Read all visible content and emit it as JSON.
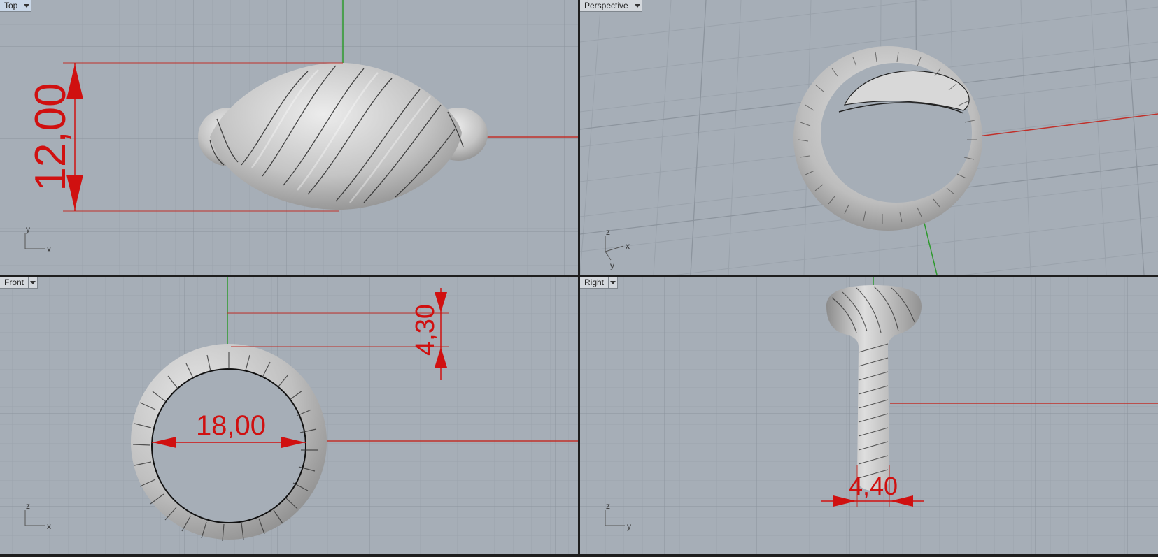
{
  "viewports": {
    "top": {
      "label": "Top",
      "axis_a": "y",
      "axis_b": "x",
      "dimension": "12,00"
    },
    "perspective": {
      "label": "Perspective",
      "axis_a": "z",
      "axis_b": "x",
      "axis_c": "y"
    },
    "front": {
      "label": "Front",
      "axis_a": "z",
      "axis_b": "x",
      "dimension_inner": "18,00",
      "dimension_top": "4,30"
    },
    "right": {
      "label": "Right",
      "axis_a": "z",
      "axis_b": "y",
      "dimension": "4,40"
    }
  },
  "colors": {
    "viewport_bg": "#a6aeb7",
    "grid_minor": "#99a1aa",
    "grid_major": "#8a929b",
    "axis_x": "#c0302a",
    "axis_y": "#2e9a2e",
    "dimension": "#d01010",
    "model": "#c9c9c9"
  },
  "icons": {
    "tab_menu": "chevron-down-icon",
    "axis_widget": "axis-triad-icon"
  }
}
